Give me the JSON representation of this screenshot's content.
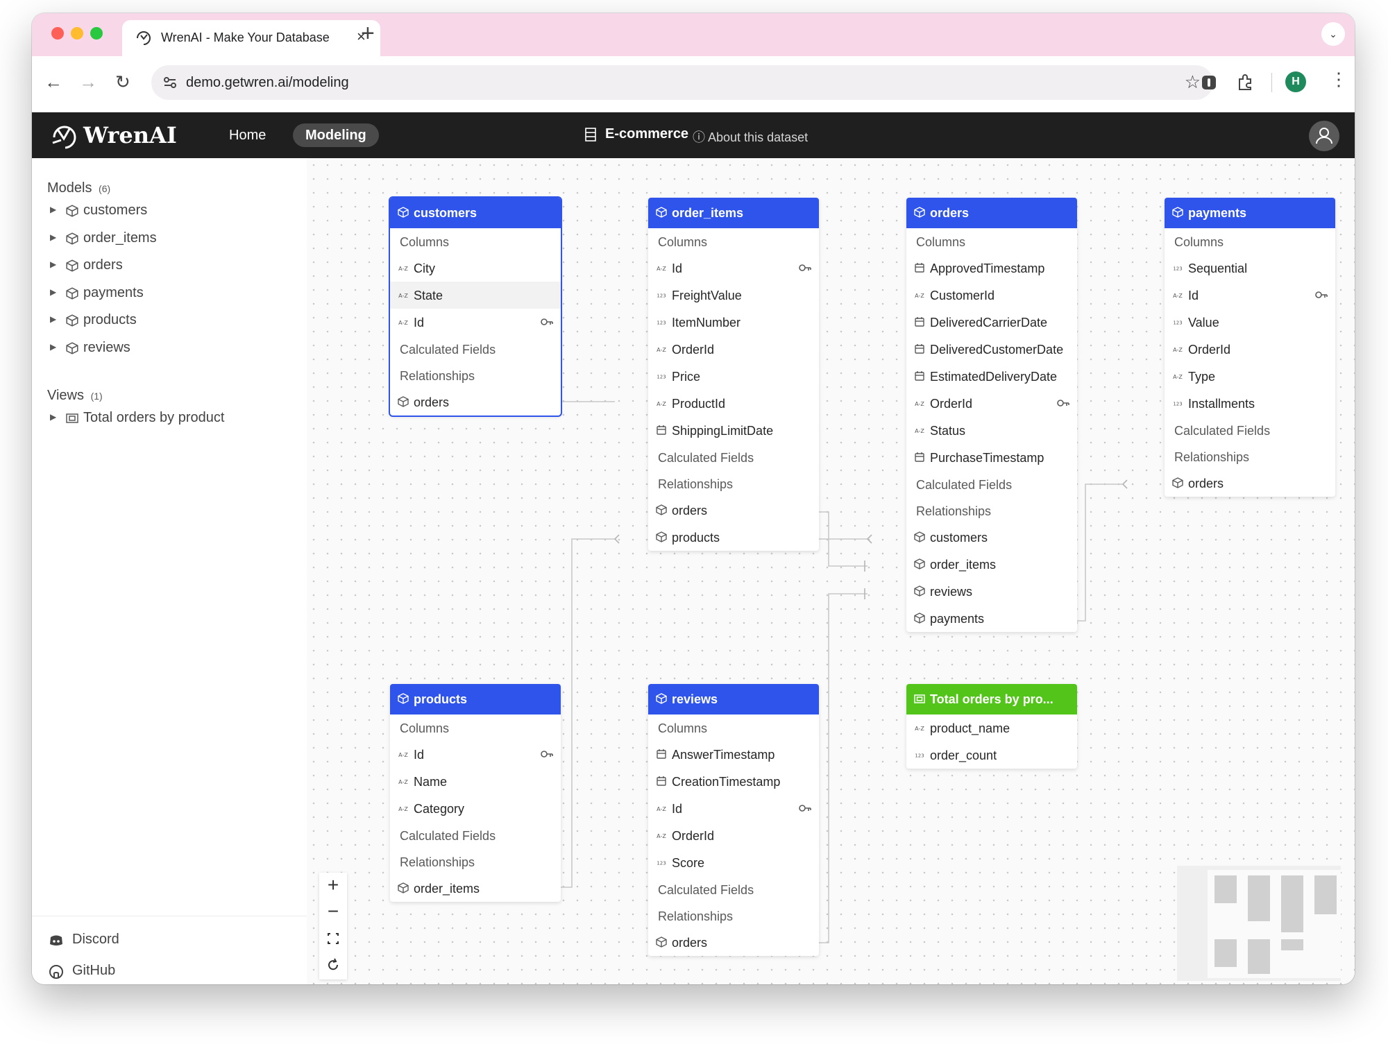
{
  "browser": {
    "tab_title": "WrenAI - Make Your Database",
    "url": "demo.getwren.ai/modeling",
    "profile_initial": "H",
    "new_tab": "+",
    "close_tab": "×"
  },
  "header": {
    "brand": "WrenAI",
    "nav": {
      "home": "Home",
      "modeling": "Modeling"
    },
    "dataset_name": "E-commerce",
    "about": "About this dataset"
  },
  "sidebar": {
    "models_heading": "Models",
    "models_count": "(6)",
    "models": [
      "customers",
      "order_items",
      "orders",
      "payments",
      "products",
      "reviews"
    ],
    "views_heading": "Views",
    "views_count": "(1)",
    "views": [
      "Total orders by product"
    ],
    "footer": {
      "discord": "Discord",
      "github": "GitHub"
    }
  },
  "diagram": {
    "columns_label": "Columns",
    "calculated_label": "Calculated Fields",
    "relationships_label": "Relationships",
    "models": {
      "customers": {
        "title": "customers",
        "columns": [
          {
            "name": "City",
            "type": "text"
          },
          {
            "name": "State",
            "type": "text"
          },
          {
            "name": "Id",
            "type": "text",
            "pk": true
          }
        ],
        "relationships": [
          "orders"
        ]
      },
      "order_items": {
        "title": "order_items",
        "columns": [
          {
            "name": "Id",
            "type": "text",
            "pk": true
          },
          {
            "name": "FreightValue",
            "type": "number"
          },
          {
            "name": "ItemNumber",
            "type": "number"
          },
          {
            "name": "OrderId",
            "type": "text"
          },
          {
            "name": "Price",
            "type": "number"
          },
          {
            "name": "ProductId",
            "type": "text"
          },
          {
            "name": "ShippingLimitDate",
            "type": "date"
          }
        ],
        "relationships": [
          "orders",
          "products"
        ]
      },
      "orders": {
        "title": "orders",
        "columns": [
          {
            "name": "ApprovedTimestamp",
            "type": "date"
          },
          {
            "name": "CustomerId",
            "type": "text"
          },
          {
            "name": "DeliveredCarrierDate",
            "type": "date"
          },
          {
            "name": "DeliveredCustomerDate",
            "type": "date"
          },
          {
            "name": "EstimatedDeliveryDate",
            "type": "date"
          },
          {
            "name": "OrderId",
            "type": "text",
            "pk": true
          },
          {
            "name": "Status",
            "type": "text"
          },
          {
            "name": "PurchaseTimestamp",
            "type": "date"
          }
        ],
        "relationships": [
          "customers",
          "order_items",
          "reviews",
          "payments"
        ]
      },
      "payments": {
        "title": "payments",
        "columns": [
          {
            "name": "Sequential",
            "type": "number"
          },
          {
            "name": "Id",
            "type": "text",
            "pk": true
          },
          {
            "name": "Value",
            "type": "number"
          },
          {
            "name": "OrderId",
            "type": "text"
          },
          {
            "name": "Type",
            "type": "text"
          },
          {
            "name": "Installments",
            "type": "number"
          }
        ],
        "relationships": [
          "orders"
        ]
      },
      "products": {
        "title": "products",
        "columns": [
          {
            "name": "Id",
            "type": "text",
            "pk": true
          },
          {
            "name": "Name",
            "type": "text"
          },
          {
            "name": "Category",
            "type": "text"
          }
        ],
        "relationships": [
          "order_items"
        ]
      },
      "reviews": {
        "title": "reviews",
        "columns": [
          {
            "name": "AnswerTimestamp",
            "type": "date"
          },
          {
            "name": "CreationTimestamp",
            "type": "date"
          },
          {
            "name": "Id",
            "type": "text",
            "pk": true
          },
          {
            "name": "OrderId",
            "type": "text"
          },
          {
            "name": "Score",
            "type": "number"
          }
        ],
        "relationships": [
          "orders"
        ]
      }
    },
    "view": {
      "title": "Total orders by pro...",
      "columns": [
        {
          "name": "product_name",
          "type": "text"
        },
        {
          "name": "order_count",
          "type": "number"
        }
      ]
    }
  },
  "controls": {
    "zoom_in": "+",
    "zoom_out": "−"
  },
  "colors": {
    "model_header": "#2f54eb",
    "view_header": "#52c41a",
    "app_header": "#1f1f1f",
    "tabstrip": "#f7d7e8"
  }
}
